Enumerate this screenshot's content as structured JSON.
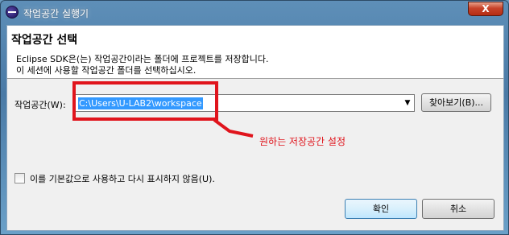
{
  "window": {
    "title": "작업공간 실행기",
    "close_glyph": "X"
  },
  "banner": {
    "title": "작업공간 선택",
    "desc_line1": "Eclipse SDK은(는) 작업공간이라는 폴더에 프로젝트를 저장합니다.",
    "desc_line2": "이 세션에 사용할 작업공간 폴더를 선택하십시오."
  },
  "workspace": {
    "label": "작업공간(W):",
    "value": "C:\\Users\\U-LAB2\\workspace",
    "dropdown_glyph": "▼",
    "browse_label": "찾아보기(B)..."
  },
  "annotation": {
    "text": "원하는 저장공간 설정",
    "color": "#e0141c"
  },
  "options": {
    "default_checkbox_label": "이를 기본값으로 사용하고 다시 표시하지 않음(U).",
    "default_checked": false
  },
  "buttons": {
    "ok_label": "확인",
    "cancel_label": "취소"
  }
}
